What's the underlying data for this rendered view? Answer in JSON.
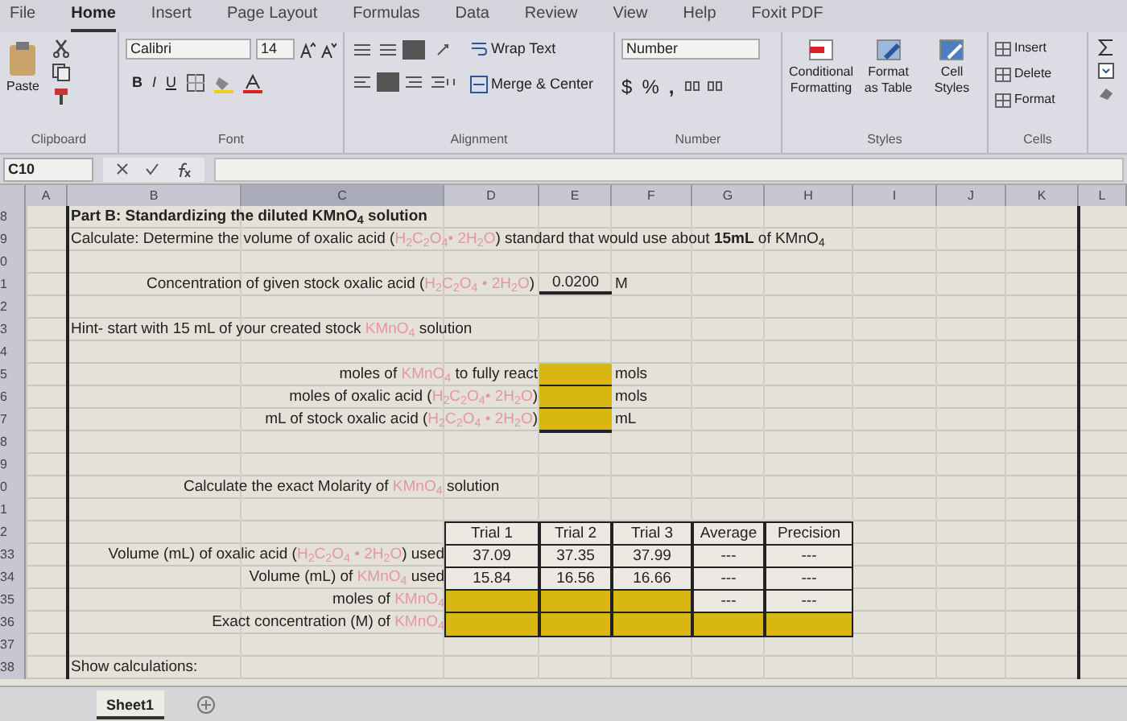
{
  "ribbon": {
    "tabs": [
      {
        "label": "File",
        "selected": false
      },
      {
        "label": "Home",
        "selected": true
      },
      {
        "label": "Insert",
        "selected": false
      },
      {
        "label": "Page Layout",
        "selected": false
      },
      {
        "label": "Formulas",
        "selected": false
      },
      {
        "label": "Data",
        "selected": false
      },
      {
        "label": "Review",
        "selected": false
      },
      {
        "label": "View",
        "selected": false
      },
      {
        "label": "Help",
        "selected": false
      },
      {
        "label": "Foxit PDF",
        "selected": false
      }
    ],
    "clipboard": {
      "paste": "Paste",
      "group": "Clipboard"
    },
    "font": {
      "name": "Calibri",
      "size": "14",
      "bold": "B",
      "italic": "I",
      "underline": "U",
      "group": "Font"
    },
    "alignment": {
      "wrap": "Wrap Text",
      "merge": "Merge & Center",
      "group": "Alignment"
    },
    "number": {
      "format": "Number",
      "currency": "$",
      "percent": "%",
      "comma": ",",
      "group": "Number"
    },
    "styles": {
      "buttons": [
        "Conditional Formatting",
        "Format as Table",
        "Cell Styles"
      ],
      "group": "Styles"
    },
    "cells": {
      "buttons": [
        "Insert",
        "Delete",
        "Format"
      ],
      "group": "Cells"
    }
  },
  "formula_bar": {
    "name_box": "C10"
  },
  "columns": [
    "A",
    "B",
    "C",
    "D",
    "E",
    "F",
    "G",
    "H",
    "I",
    "J",
    "K",
    "L"
  ],
  "rows": [
    {
      "number": "8",
      "kind": "title",
      "segments": [
        {
          "kind": "text",
          "text": "Part B: Standardizing the diluted KMnO$_{4}$ solution"
        }
      ]
    },
    {
      "number": "9",
      "kind": "sentence",
      "segments": [
        {
          "kind": "text",
          "text": "Calculate: Determine the volume of oxalic acid ("
        },
        {
          "kind": "formula",
          "text": "H$_{2}$C$_{2}$O$_{4}$• 2H$_{2}$O"
        },
        {
          "kind": "text",
          "text": ") standard that would use about **15mL** of KMnO$_{4}$"
        }
      ]
    },
    {
      "number": "0",
      "kind": "blank"
    },
    {
      "number": "1",
      "kind": "value",
      "segments": [
        {
          "kind": "text",
          "text": "Concentration of given stock oxalic acid ("
        },
        {
          "kind": "formula",
          "text": "H$_{2}$C$_{2}$O$_{4}$ • 2H$_{2}$O"
        },
        {
          "kind": "text",
          "text": ")"
        }
      ],
      "value": "0.0200",
      "unit": "M"
    },
    {
      "number": "2",
      "kind": "blank"
    },
    {
      "number": "3",
      "kind": "sentence",
      "segments": [
        {
          "kind": "text",
          "text": "Hint- start with 15 mL of your created stock "
        },
        {
          "kind": "formula",
          "text": "KMnO$_{4}$"
        },
        {
          "kind": "text",
          "text": " solution"
        }
      ]
    },
    {
      "number": "4",
      "kind": "blank"
    },
    {
      "number": "5",
      "kind": "input",
      "segments": [
        {
          "kind": "text",
          "text": "moles of "
        },
        {
          "kind": "formula",
          "text": "KMnO$_{4}$"
        },
        {
          "kind": "text",
          "text": " to fully react"
        }
      ],
      "unit": "mols"
    },
    {
      "number": "6",
      "kind": "input",
      "segments": [
        {
          "kind": "text",
          "text": "moles of oxalic acid ("
        },
        {
          "kind": "formula",
          "text": "H$_{2}$C$_{2}$O$_{4}$• 2H$_{2}$O"
        },
        {
          "kind": "text",
          "text": ")"
        }
      ],
      "unit": "mols"
    },
    {
      "number": "7",
      "kind": "input",
      "segments": [
        {
          "kind": "text",
          "text": "mL of stock oxalic acid ("
        },
        {
          "kind": "formula",
          "text": "H$_{2}$C$_{2}$O$_{4}$ • 2H$_{2}$O"
        },
        {
          "kind": "text",
          "text": ")"
        }
      ],
      "unit": "mL"
    },
    {
      "number": "8",
      "kind": "blank"
    },
    {
      "number": "9",
      "kind": "blank"
    },
    {
      "number": "0",
      "kind": "heading",
      "segments": [
        {
          "kind": "text",
          "text": "Calculate the exact Molarity of "
        },
        {
          "kind": "formula",
          "text": "KMnO$_{4}$"
        },
        {
          "kind": "text",
          "text": " solution"
        }
      ]
    },
    {
      "number": "1",
      "kind": "blank"
    },
    {
      "number": "2",
      "kind": "table",
      "cells": [
        {
          "kind": "value",
          "text": "Trial 1"
        },
        {
          "kind": "value",
          "text": "Trial 2"
        },
        {
          "kind": "value",
          "text": "Trial 3"
        },
        {
          "kind": "value",
          "text": "Average"
        },
        {
          "kind": "value",
          "text": "Precision"
        }
      ]
    },
    {
      "number": "33",
      "kind": "table",
      "segments": [
        {
          "kind": "text",
          "text": "Volume (mL) of oxalic acid ("
        },
        {
          "kind": "formula",
          "text": "H$_{2}$C$_{2}$O$_{4}$ • 2H$_{2}$O"
        },
        {
          "kind": "text",
          "text": ") used"
        }
      ],
      "cells": [
        {
          "kind": "value",
          "text": "37.09"
        },
        {
          "kind": "value",
          "text": "37.35"
        },
        {
          "kind": "value",
          "text": "37.99"
        },
        {
          "kind": "value",
          "text": "---"
        },
        {
          "kind": "value",
          "text": "---"
        }
      ]
    },
    {
      "number": "34",
      "kind": "table",
      "segments": [
        {
          "kind": "text",
          "text": "Volume (mL) of "
        },
        {
          "kind": "formula",
          "text": "KMnO$_{4}$"
        },
        {
          "kind": "text",
          "text": " used"
        }
      ],
      "cells": [
        {
          "kind": "value",
          "text": "15.84"
        },
        {
          "kind": "value",
          "text": "16.56"
        },
        {
          "kind": "value",
          "text": "16.66"
        },
        {
          "kind": "value",
          "text": "---"
        },
        {
          "kind": "value",
          "text": "---"
        }
      ]
    },
    {
      "number": "35",
      "kind": "table",
      "segments": [
        {
          "kind": "text",
          "text": "moles of "
        },
        {
          "kind": "formula",
          "text": "KMnO$_{4}$"
        }
      ],
      "cells": [
        {
          "kind": "input"
        },
        {
          "kind": "input"
        },
        {
          "kind": "input"
        },
        {
          "kind": "value",
          "text": "---"
        },
        {
          "kind": "value",
          "text": "---"
        }
      ]
    },
    {
      "number": "36",
      "kind": "table",
      "segments": [
        {
          "kind": "text",
          "text": "Exact concentration (M) of "
        },
        {
          "kind": "formula",
          "text": "KMnO$_{4}$"
        }
      ],
      "cells": [
        {
          "kind": "input"
        },
        {
          "kind": "input"
        },
        {
          "kind": "input"
        },
        {
          "kind": "input"
        },
        {
          "kind": "input"
        }
      ]
    },
    {
      "number": "37",
      "kind": "blank"
    },
    {
      "number": "38",
      "kind": "sentence",
      "segments": [
        {
          "kind": "text",
          "text": "Show calculations:"
        }
      ]
    }
  ],
  "sheet_tabs": [
    {
      "label": "Sheet1",
      "selected": true
    }
  ]
}
